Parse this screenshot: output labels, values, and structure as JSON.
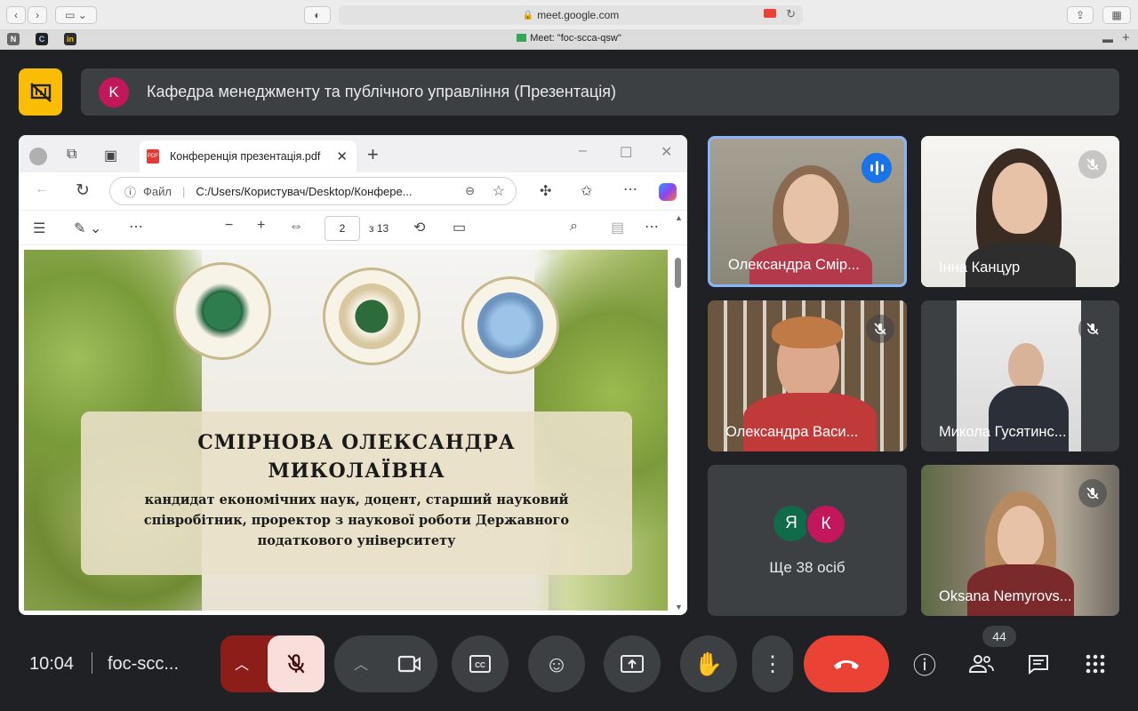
{
  "browser": {
    "url": "meet.google.com",
    "tab_title": "Meet: \"foc-scca-qsw\""
  },
  "header": {
    "avatar_letter": "K",
    "title": "Кафедра менеджменту та публічного управління (Презентація)"
  },
  "edge": {
    "tab_title": "Конференція презентація.pdf",
    "file_label": "Файл",
    "address": "C:/Users/Користувач/Desktop/Конфере...",
    "page_current": "2",
    "page_total": "з 13"
  },
  "slide": {
    "name_line1": "СМІРНОВА ОЛЕКСАНДРА",
    "name_line2": "МИКОЛАЇВНА",
    "description": "кандидат економічних наук, доцент, старший науковий співробітник,  проректор з наукової роботи Державного податкового університету"
  },
  "participants": [
    {
      "name": "Олександра Смір..."
    },
    {
      "name": "Інна Канцур"
    },
    {
      "name": "Олександра Васи..."
    },
    {
      "name": "Микола Гусятинс..."
    },
    {
      "letters": [
        "Я",
        "К"
      ],
      "label": "Ще 38 осіб"
    },
    {
      "name": "Oksana Nemyrovs..."
    }
  ],
  "footer": {
    "time": "10:04",
    "meeting_code": "foc-scc...",
    "participant_count": "44"
  },
  "colors": {
    "accent_yellow": "#fbbc04",
    "end_call_red": "#ea4335",
    "mic_off_bg": "#f9dedc",
    "speaking_blue": "#8ab4f8"
  }
}
